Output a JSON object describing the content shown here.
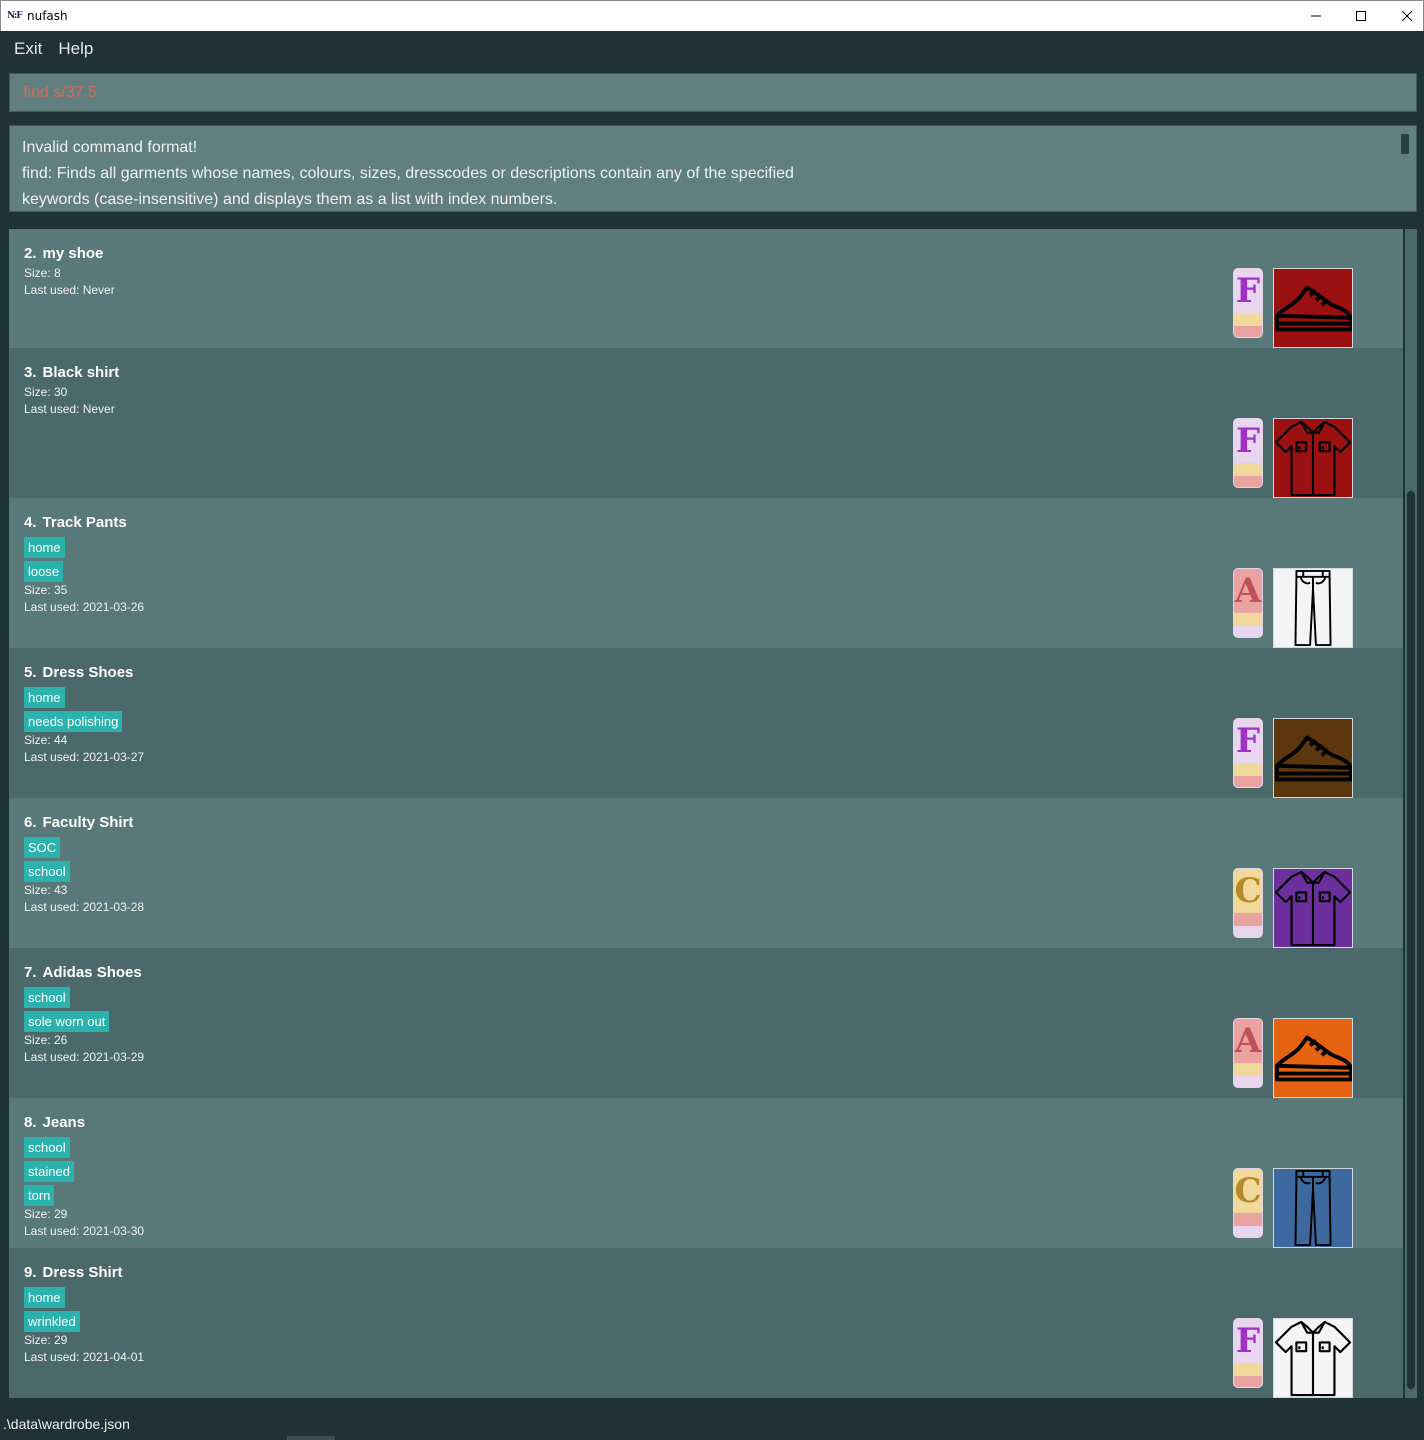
{
  "window": {
    "title": "nufash",
    "app_icon_text": "N:F"
  },
  "menu": {
    "exit_label": "Exit",
    "help_label": "Help"
  },
  "command": {
    "value": "find s/37.5"
  },
  "result": {
    "lines": [
      "Invalid command format!",
      "find: Finds all garments whose names, colours, sizes, dresscodes or descriptions contain any of the specified",
      "keywords (case-insensitive) and displays them as a list with index numbers."
    ]
  },
  "garments": [
    {
      "index": "2.",
      "name": "my shoe",
      "tags": [],
      "size": "Size: 8",
      "last_used": "Last used: Never",
      "dresscode": "F",
      "dresscode_name": "formal",
      "type": "shoe",
      "colour": "#9b1111"
    },
    {
      "index": "3.",
      "name": "Black shirt",
      "tags": [],
      "size": "Size: 30",
      "last_used": "Last used: Never",
      "dresscode": "F",
      "dresscode_name": "formal",
      "type": "shirt",
      "colour": "#9b1111"
    },
    {
      "index": "4.",
      "name": "Track Pants",
      "tags": [
        "home",
        "loose"
      ],
      "size": "Size: 35",
      "last_used": "Last used: 2021-03-26",
      "dresscode": "A",
      "dresscode_name": "active",
      "type": "pants",
      "colour": "#f4f4f4"
    },
    {
      "index": "5.",
      "name": "Dress Shoes",
      "tags": [
        "home",
        "needs polishing"
      ],
      "size": "Size: 44",
      "last_used": "Last used: 2021-03-27",
      "dresscode": "F",
      "dresscode_name": "formal",
      "type": "shoe",
      "colour": "#5c360c"
    },
    {
      "index": "6.",
      "name": "Faculty Shirt",
      "tags": [
        "SOC",
        "school"
      ],
      "size": "Size: 43",
      "last_used": "Last used: 2021-03-28",
      "dresscode": "C",
      "dresscode_name": "casual",
      "type": "shirt",
      "colour": "#6d2f9e"
    },
    {
      "index": "7.",
      "name": "Adidas Shoes",
      "tags": [
        "school",
        "sole worn out"
      ],
      "size": "Size: 26",
      "last_used": "Last used: 2021-03-29",
      "dresscode": "A",
      "dresscode_name": "active",
      "type": "shoe",
      "colour": "#e56211"
    },
    {
      "index": "8.",
      "name": "Jeans",
      "tags": [
        "school",
        "stained",
        "torn"
      ],
      "size": "Size: 29",
      "last_used": "Last used: 2021-03-30",
      "dresscode": "C",
      "dresscode_name": "casual",
      "type": "pants",
      "colour": "#3d69a0"
    },
    {
      "index": "9.",
      "name": "Dress Shirt",
      "tags": [
        "home",
        "wrinkled"
      ],
      "size": "Size: 29",
      "last_used": "Last used: 2021-04-01",
      "dresscode": "F",
      "dresscode_name": "formal",
      "type": "shirt",
      "colour": "#f4f4f4"
    }
  ],
  "status": {
    "file_path": ".\\data\\wardrobe.json"
  },
  "icons": {
    "minimize": "minimize-icon",
    "maximize": "maximize-icon",
    "close": "close-icon",
    "shoe": "shoe-icon",
    "shirt": "shirt-icon",
    "pants": "pants-icon"
  }
}
